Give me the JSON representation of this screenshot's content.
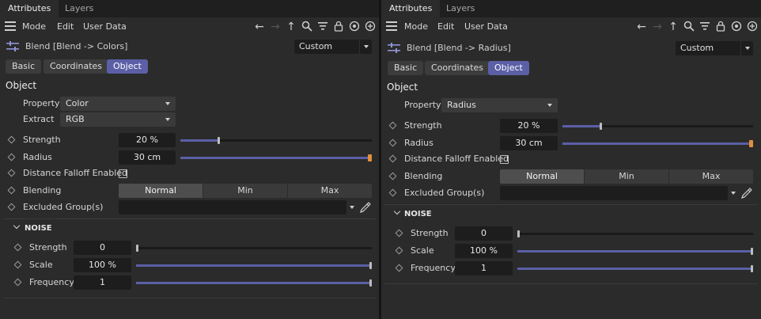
{
  "left": {
    "tabs": [
      "Attributes",
      "Layers"
    ],
    "menu": [
      "Mode",
      "Edit",
      "User Data"
    ],
    "object_title": "Blend [Blend -> Colors]",
    "preset": "Custom",
    "subtabs": [
      "Basic",
      "Coordinates",
      "Object"
    ],
    "section": "Object",
    "property_label": "Property",
    "property_value": "Color",
    "extract_label": "Extract",
    "extract_value": "RGB",
    "strength_label": "Strength",
    "strength_value": "20 %",
    "strength_fraction": 0.2,
    "radius_label": "Radius",
    "radius_value": "30 cm",
    "radius_fraction": 1.0,
    "distance_falloff_label": "Distance Falloff Enabled",
    "blending_label": "Blending",
    "blending_options": [
      "Normal",
      "Min",
      "Max"
    ],
    "excluded_label": "Excluded Group(s)",
    "noise_title": "NOISE",
    "noise_strength_label": "Strength",
    "noise_strength_value": "0",
    "noise_scale_label": "Scale",
    "noise_scale_value": "100 %",
    "noise_frequency_label": "Frequency",
    "noise_frequency_value": "1"
  },
  "right": {
    "tabs": [
      "Attributes",
      "Layers"
    ],
    "menu": [
      "Mode",
      "Edit",
      "User Data"
    ],
    "object_title": "Blend [Blend -> Radius]",
    "preset": "Custom",
    "subtabs": [
      "Basic",
      "Coordinates",
      "Object"
    ],
    "section": "Object",
    "property_label": "Property",
    "property_value": "Radius",
    "strength_label": "Strength",
    "strength_value": "20 %",
    "strength_fraction": 0.2,
    "radius_label": "Radius",
    "radius_value": "30 cm",
    "radius_fraction": 1.0,
    "distance_falloff_label": "Distance Falloff Enabled",
    "blending_label": "Blending",
    "blending_options": [
      "Normal",
      "Min",
      "Max"
    ],
    "excluded_label": "Excluded Group(s)",
    "noise_title": "NOISE",
    "noise_strength_label": "Strength",
    "noise_strength_value": "0",
    "noise_scale_label": "Scale",
    "noise_scale_value": "100 %",
    "noise_frequency_label": "Frequency",
    "noise_frequency_value": "1"
  },
  "colors": {
    "accent": "#5b5fa6",
    "radius_knob": "#e28f3c"
  },
  "icons": [
    "menu-icon",
    "back-arrow-icon",
    "forward-arrow-icon",
    "up-arrow-icon",
    "search-icon",
    "filter-icon",
    "lock-icon",
    "target-icon",
    "add-icon",
    "blend-icon",
    "eyedropper-icon"
  ]
}
